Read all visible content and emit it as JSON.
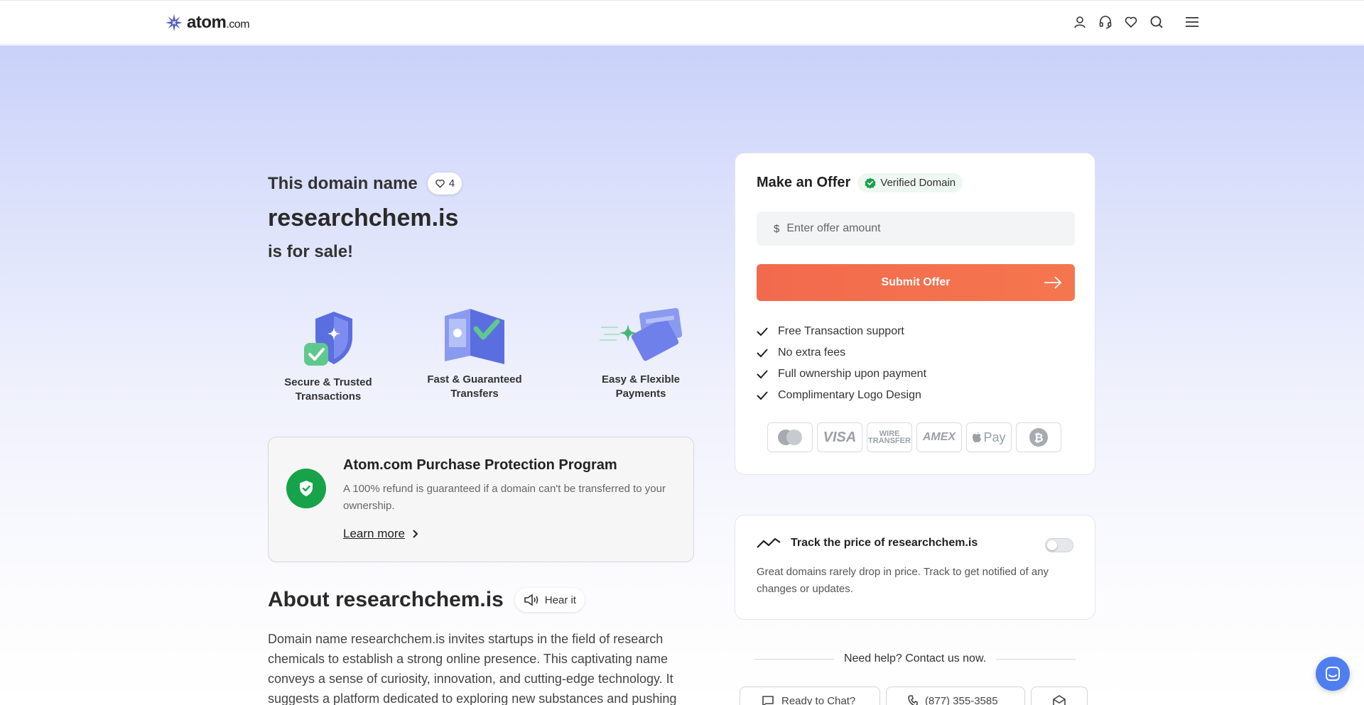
{
  "header": {
    "logo_main": "atom",
    "logo_suffix": ".com",
    "icons": [
      "user-icon",
      "headset-icon",
      "heart-icon",
      "search-icon",
      "menu-icon"
    ]
  },
  "hero": {
    "title_pre": "This domain name",
    "like_count": "4",
    "domain": "researchchem.is",
    "for_sale": "is for sale!"
  },
  "features": [
    {
      "label": "Secure & Trusted Transactions",
      "icon": "shield-icon"
    },
    {
      "label": "Fast & Guaranteed Transfers",
      "icon": "transfer-icon"
    },
    {
      "label": "Easy & Flexible Payments",
      "icon": "cards-icon"
    }
  ],
  "protection": {
    "title": "Atom.com Purchase Protection Program",
    "description": "A 100% refund is guaranteed if a domain can't be transferred to your ownership.",
    "link": "Learn more"
  },
  "about": {
    "title": "About researchchem.is",
    "hear_label": "Hear it",
    "text": "Domain name researchchem.is invites startups in the field of research chemicals to establish a strong online presence. This captivating name conveys a sense of curiosity, innovation, and cutting-edge technology. It suggests a platform dedicated to exploring new substances and pushing the"
  },
  "offer": {
    "title": "Make an Offer",
    "verified": "Verified Domain",
    "currency": "$",
    "placeholder": "Enter offer amount",
    "submit": "Submit Offer",
    "benefits": [
      "Free Transaction support",
      "No extra fees",
      "Full ownership upon payment",
      "Complimentary Logo Design"
    ],
    "payments": [
      "mastercard",
      "VISA",
      "WIRE TRANSFER",
      "AMEX",
      "Pay",
      "bitcoin"
    ]
  },
  "track": {
    "title": "Track the price of researchchem.is",
    "description": "Great domains rarely drop in price. Track to get notified of any changes or updates.",
    "enabled": false
  },
  "help": {
    "text": "Need help? Contact us now.",
    "contacts": [
      "Ready to Chat?",
      "(877) 355-3585",
      ""
    ]
  },
  "colors": {
    "accent": "#f26a4d",
    "green": "#16a34a",
    "brand_blue": "#4f7ef0"
  }
}
